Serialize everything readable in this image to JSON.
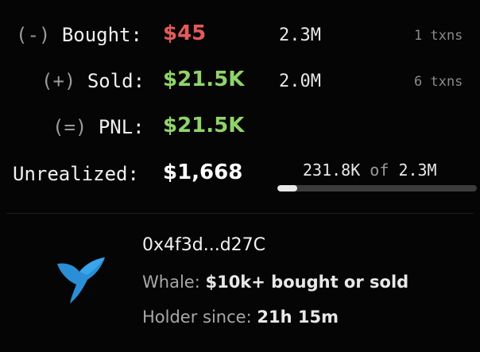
{
  "rows": [
    {
      "paren": "(-)",
      "label": "Bought:",
      "value": "$45",
      "amount": "2.3M",
      "txns": "1 txns"
    },
    {
      "paren": "(+)",
      "label": "Sold:",
      "value": "$21.5K",
      "amount": "2.0M",
      "txns": "6 txns"
    },
    {
      "paren": "(=)",
      "label": "PNL:",
      "value": "$21.5K"
    }
  ],
  "unrealized": {
    "label": "Unrealized:",
    "value": "$1,668",
    "held": "231.8K",
    "of": "of",
    "total": "2.3M",
    "progress_fraction": 0.1
  },
  "holder": {
    "address": "0x4f3d...d27C",
    "type_label": "Whale:",
    "type_value": "$10k+ bought or sold",
    "since_label": "Holder since:",
    "since_value": "21h 15m",
    "icon": "whale-tail-icon"
  },
  "colors": {
    "negative": "#e55a5a",
    "positive": "#8fd46a",
    "whale": "#2a8fd6"
  }
}
